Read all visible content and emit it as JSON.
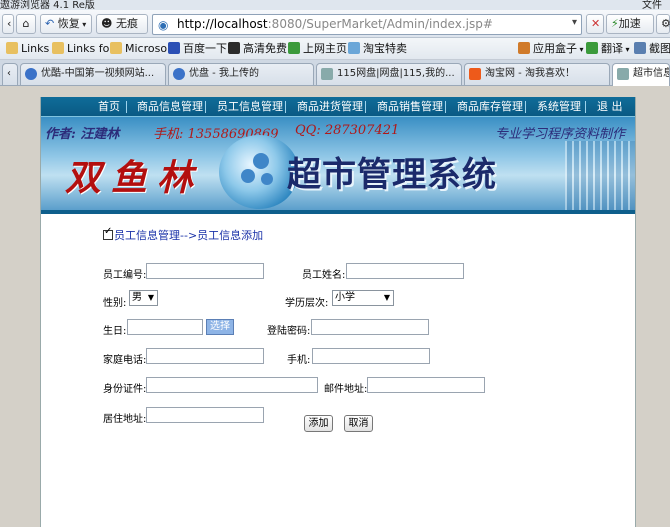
{
  "browser": {
    "title_left": "遨游浏览器 4.1 Re版",
    "title_right": "文件",
    "back_label": "",
    "recover_label": "恢复",
    "noscope_label": "无痕",
    "url_host": "http://localhost",
    "url_path": ":8080/SuperMarket/Admin/index.jsp#",
    "accelerate_label": "加速",
    "bookmarks": [
      "Links",
      "Links fo",
      "Microso",
      "百度一下",
      "高清免费",
      "上网主页",
      "淘宝特卖"
    ],
    "bookmarks_right": [
      "应用盒子",
      "翻译",
      "截图"
    ],
    "tabs": [
      "优酷-中国第一视频网站...",
      "优盘 - 我上传的",
      "115网盘|网盘|115,我的...",
      "淘宝网 - 淘我喜欢！",
      "超市信息"
    ]
  },
  "menu": {
    "items": [
      "首页",
      "商品信息管理",
      "员工信息管理",
      "商品进货管理",
      "商品销售管理",
      "商品库存管理",
      "系统管理",
      "退 出"
    ]
  },
  "banner": {
    "author": "作者: 汪建林",
    "phone": "手机: 13558690869",
    "qq": "QQ: 287307421",
    "slogan": "专业学习程序资料制作",
    "logo": "双鱼林",
    "system_title": "超市管理系统"
  },
  "breadcrumb": "员工信息管理-->员工信息添加",
  "form": {
    "employee_no_label": "员工编号:",
    "employee_no_value": "",
    "employee_name_label": "员工姓名:",
    "employee_name_value": "",
    "gender_label": "性别:",
    "gender_value": "男",
    "education_label": "学历层次:",
    "education_value": "小学",
    "birthday_label": "生日:",
    "birthday_value": "",
    "choose_label": "选择",
    "password_label": "登陆密码:",
    "password_value": "",
    "home_phone_label": "家庭电话:",
    "home_phone_value": "",
    "mobile_label": "手机:",
    "mobile_value": "",
    "id_card_label": "身份证件:",
    "id_card_value": "",
    "email_label": "邮件地址:",
    "email_value": "",
    "address_label": "居住地址:",
    "address_value": "",
    "add_label": "添加",
    "cancel_label": "取消"
  }
}
